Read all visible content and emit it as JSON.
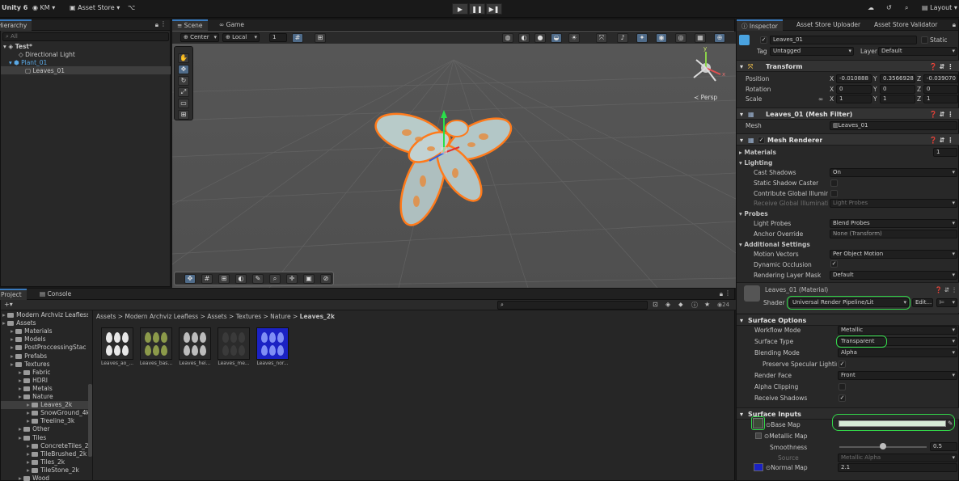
{
  "topbar": {
    "app": "Unity 6",
    "account": "KM",
    "asset_store": "Asset Store",
    "play": "▶",
    "pause": "❚❚",
    "step": "▶❚",
    "layout": "Layout"
  },
  "hierarchy": {
    "tab": "Hierarchy",
    "search_placeholder": "All",
    "scene": "Test*",
    "items": [
      "Directional Light",
      "Plant_01",
      "Leaves_01"
    ]
  },
  "scene": {
    "tabs": [
      "Scene",
      "Game"
    ],
    "pivot": "Center",
    "space": "Local",
    "grid_value": "1",
    "persp": "Persp",
    "axis_y": "y",
    "axis_x": "x"
  },
  "project": {
    "tabs": [
      "Project",
      "Console"
    ],
    "count": "24",
    "breadcrumb": [
      "Assets",
      "Modern Archviz Leafless",
      "Assets",
      "Textures",
      "Nature",
      "Leaves_2k"
    ],
    "tree": [
      {
        "label": "Modern Archviz Leafless",
        "indent": 0
      },
      {
        "label": "Assets",
        "indent": 0
      },
      {
        "label": "Materials",
        "indent": 1
      },
      {
        "label": "Models",
        "indent": 1
      },
      {
        "label": "PostProccessingStac",
        "indent": 1
      },
      {
        "label": "Prefabs",
        "indent": 1
      },
      {
        "label": "Textures",
        "indent": 1
      },
      {
        "label": "Fabric",
        "indent": 2
      },
      {
        "label": "HDRI",
        "indent": 2
      },
      {
        "label": "Metals",
        "indent": 2
      },
      {
        "label": "Nature",
        "indent": 2
      },
      {
        "label": "Leaves_2k",
        "indent": 3
      },
      {
        "label": "SnowGround_4k",
        "indent": 3
      },
      {
        "label": "Treeline_3k",
        "indent": 3
      },
      {
        "label": "Other",
        "indent": 2
      },
      {
        "label": "Tiles",
        "indent": 2
      },
      {
        "label": "ConcreteTiles_2",
        "indent": 3
      },
      {
        "label": "TileBrushed_2k",
        "indent": 3
      },
      {
        "label": "Tiles_2k",
        "indent": 3
      },
      {
        "label": "TileStone_2k",
        "indent": 3
      },
      {
        "label": "Wood",
        "indent": 2
      }
    ],
    "assets": [
      {
        "label": "Leaves_ao_...",
        "color": "#e8e8e8",
        "bg": "#2b2b2b"
      },
      {
        "label": "Leaves_bas...",
        "color": "#8c9a4a",
        "bg": "#2b2b2b"
      },
      {
        "label": "Leaves_hei...",
        "color": "#bdbdbd",
        "bg": "#2b2b2b"
      },
      {
        "label": "Leaves_me...",
        "color": "#3a3a3a",
        "bg": "#2b2b2b"
      },
      {
        "label": "Leaves_nor...",
        "color": "#7f8ef5",
        "bg": "#1b22c4"
      }
    ]
  },
  "inspector": {
    "tabs": [
      "Inspector",
      "Asset Store Uploader",
      "Asset Store Validator"
    ],
    "object_name": "Leaves_01",
    "static": "Static",
    "tag_label": "Tag",
    "tag": "Untagged",
    "layer_label": "Layer",
    "layer": "Default",
    "transform": {
      "title": "Transform",
      "position_label": "Position",
      "rotation_label": "Rotation",
      "scale_label": "Scale",
      "position": [
        "-0.010888",
        "0.3566928",
        "-0.039070"
      ],
      "rotation": [
        "0",
        "0",
        "0"
      ],
      "scale": [
        "1",
        "1",
        "1"
      ]
    },
    "mesh_filter": {
      "title": "Leaves_01 (Mesh Filter)",
      "mesh_label": "Mesh",
      "mesh": "Leaves_01"
    },
    "mesh_renderer": {
      "title": "Mesh Renderer",
      "materials_label": "Materials",
      "materials_count": "1",
      "lighting": "Lighting",
      "cast_shadows_label": "Cast Shadows",
      "cast_shadows": "On",
      "static_shadow_label": "Static Shadow Caster",
      "contribute_gi_label": "Contribute Global Illumina",
      "receive_gi_label": "Receive Global Illuminatio",
      "receive_gi": "Light Probes",
      "probes": "Probes",
      "light_probes_label": "Light Probes",
      "light_probes": "Blend Probes",
      "anchor_label": "Anchor Override",
      "anchor": "None (Transform)",
      "additional": "Additional Settings",
      "motion_label": "Motion Vectors",
      "motion": "Per Object Motion",
      "dynamic_occlusion_label": "Dynamic Occlusion",
      "rendering_layer_label": "Rendering Layer Mask",
      "rendering_layer": "Default"
    },
    "material": {
      "title": "Leaves_01 (Material)",
      "shader_label": "Shader",
      "shader": "Universal Render Pipeline/Lit",
      "edit": "Edit...",
      "surface_options": "Surface Options",
      "workflow_label": "Workflow Mode",
      "workflow": "Metallic",
      "surface_type_label": "Surface Type",
      "surface_type": "Transparent",
      "blending_label": "Blending Mode",
      "blending": "Alpha",
      "preserve_label": "Preserve Specular Lighting",
      "render_face_label": "Render Face",
      "render_face": "Front",
      "alpha_clip_label": "Alpha Clipping",
      "receive_shadows_label": "Receive Shadows",
      "surface_inputs": "Surface Inputs",
      "base_map_label": "Base Map",
      "metallic_map_label": "Metallic Map",
      "smoothness_label": "Smoothness",
      "smoothness": "0.5",
      "source_label": "Source",
      "source": "Metallic Alpha",
      "normal_map_label": "Normal Map",
      "normal_value": "2.1"
    }
  },
  "colors": {
    "accent": "#3a79bb",
    "highlight": "#33d84a",
    "selection_outline": "#ff7a1a"
  }
}
